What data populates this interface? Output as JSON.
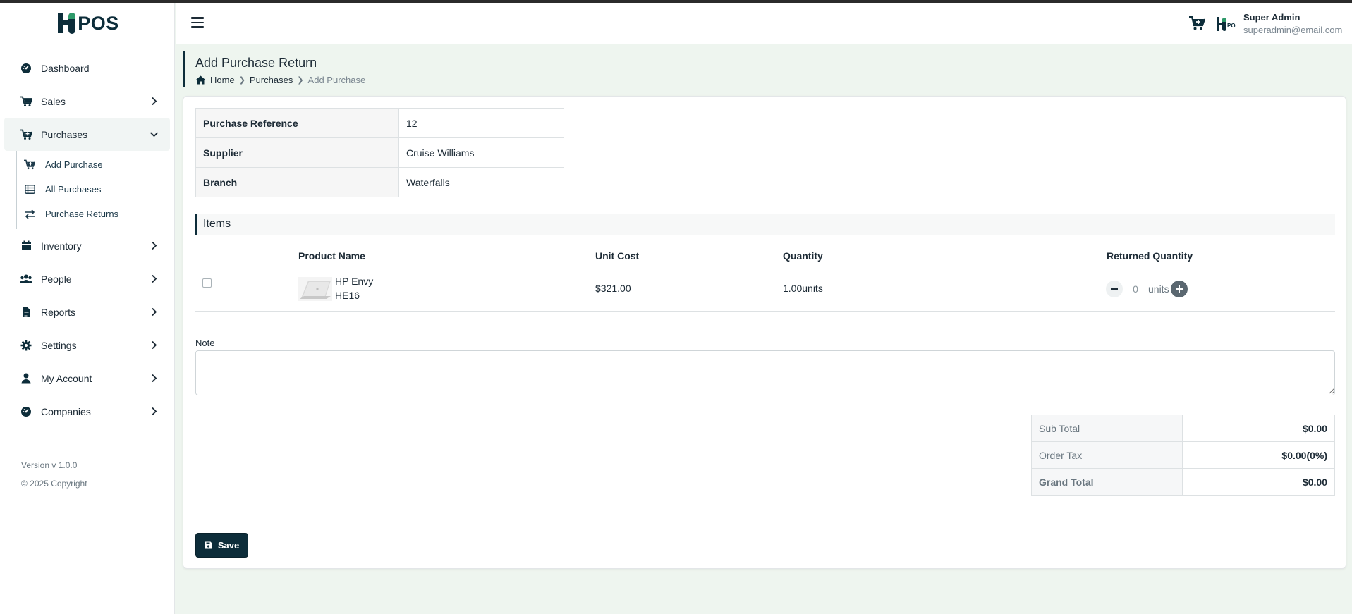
{
  "brand": {
    "name": "POS"
  },
  "sidebar": {
    "items": [
      {
        "label": "Dashboard",
        "icon": "gauge-icon"
      },
      {
        "label": "Sales",
        "icon": "cart-icon"
      },
      {
        "label": "Purchases",
        "icon": "cart-plus-icon",
        "expanded": true,
        "children": [
          {
            "label": "Add Purchase",
            "icon": "cart-plus-icon"
          },
          {
            "label": "All Purchases",
            "icon": "list-icon"
          },
          {
            "label": "Purchase Returns",
            "icon": "exchange-icon"
          }
        ]
      },
      {
        "label": "Inventory",
        "icon": "inventory-icon"
      },
      {
        "label": "People",
        "icon": "users-icon"
      },
      {
        "label": "Reports",
        "icon": "file-icon"
      },
      {
        "label": "Settings",
        "icon": "gear-icon"
      },
      {
        "label": "My Account",
        "icon": "user-icon"
      },
      {
        "label": "Companies",
        "icon": "gauge-icon"
      }
    ],
    "version": "Version v 1.0.0",
    "copyright": "© 2025 Copyright"
  },
  "header": {
    "user_name": "Super Admin",
    "user_email": "superadmin@email.com"
  },
  "page": {
    "title": "Add Purchase Return",
    "breadcrumb": [
      "Home",
      "Purchases",
      "Add Purchase"
    ]
  },
  "info": [
    {
      "label": "Purchase Reference",
      "value": "12"
    },
    {
      "label": "Supplier",
      "value": "Cruise Williams"
    },
    {
      "label": "Branch",
      "value": "Waterfalls"
    }
  ],
  "items_section": {
    "title": "Items",
    "columns": [
      "Product Name",
      "Unit Cost",
      "Quantity",
      "Returned Quantity"
    ],
    "rows": [
      {
        "name": "HP Envy",
        "code": "HE16",
        "unit_cost": "$321.00",
        "quantity": "1.00units",
        "returned_qty": "0",
        "unit": "units",
        "checked": false
      }
    ]
  },
  "note": {
    "label": "Note",
    "value": ""
  },
  "totals": [
    {
      "label": "Sub Total",
      "value": "$0.00"
    },
    {
      "label": "Order Tax",
      "value": "$0.00(0%)"
    },
    {
      "label": "Grand Total",
      "value": "$0.00"
    }
  ],
  "actions": {
    "save_label": "Save"
  },
  "colors": {
    "primary": "#0d2d3a",
    "background": "#eef5ef"
  }
}
